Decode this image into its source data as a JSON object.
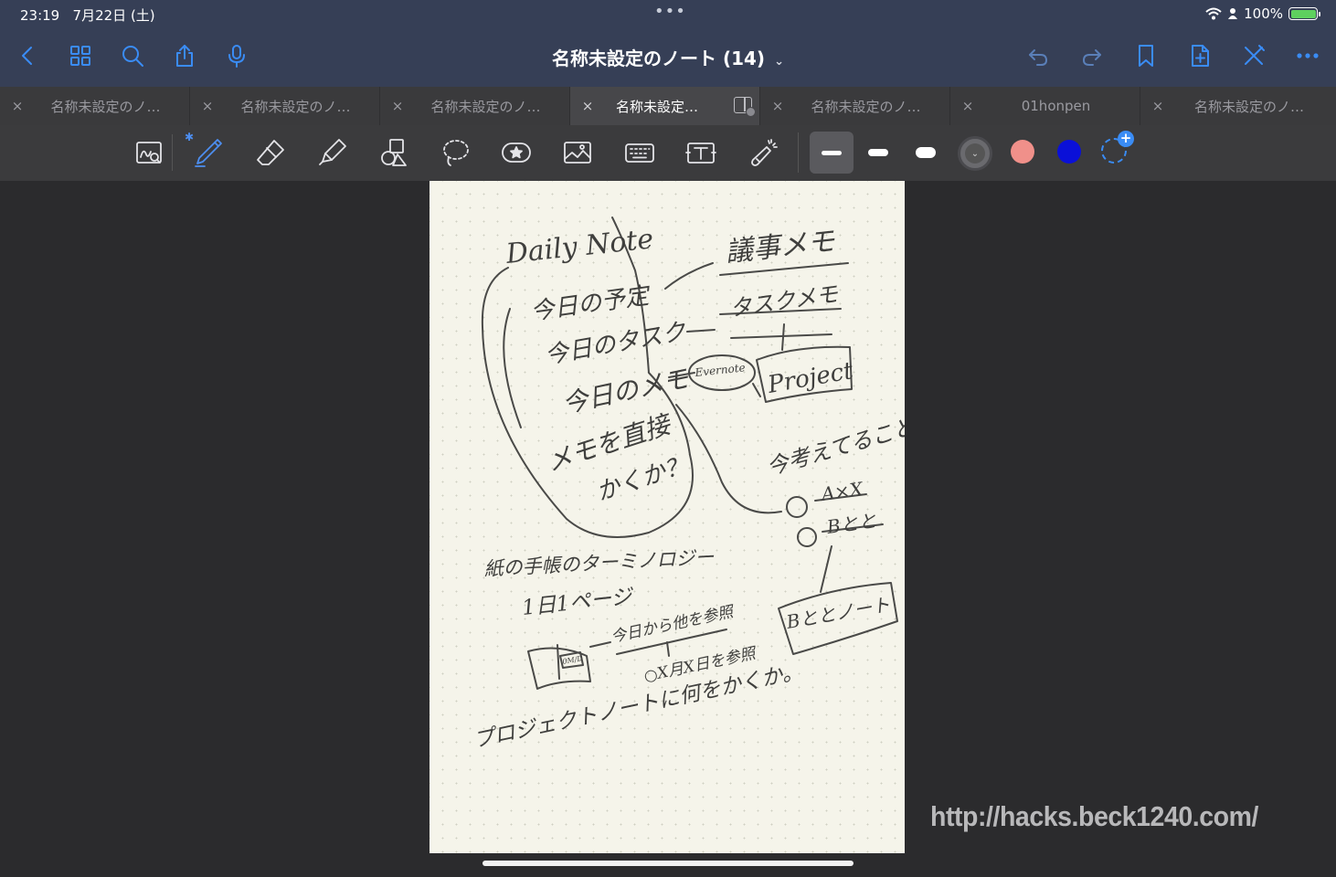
{
  "status": {
    "time": "23:19",
    "date": "7月22日 (土)",
    "battery": "100%",
    "dots": "•••"
  },
  "nav": {
    "title": "名称未設定のノート (14)",
    "title_chevron": "⌄",
    "left_icons": [
      "back-icon",
      "grid-icon",
      "search-icon",
      "share-icon",
      "microphone-icon"
    ],
    "right_icons": [
      "undo-icon",
      "redo-icon",
      "bookmark-icon",
      "add-page-icon",
      "close-pen-icon",
      "more-icon"
    ]
  },
  "tabs": [
    {
      "label": "名称未設定のノ…",
      "close": "×"
    },
    {
      "label": "名称未設定のノ…",
      "close": "×"
    },
    {
      "label": "名称未設定のノ…",
      "close": "×"
    },
    {
      "label": "名称未設定…",
      "close": "×",
      "active": true
    },
    {
      "label": "名称未設定のノ…",
      "close": "×"
    },
    {
      "label": "01honpen",
      "close": "×"
    },
    {
      "label": "名称未設定のノ…",
      "close": "×"
    }
  ],
  "toolbar": {
    "tools": [
      "zoom-window-icon",
      "pen-icon",
      "eraser-icon",
      "highlighter-icon",
      "shapes-icon",
      "lasso-icon",
      "sticker-icon",
      "image-icon",
      "keyboard-icon",
      "text-box-icon",
      "laser-pointer-icon"
    ],
    "bluetooth": "✱",
    "stroke_widths": [
      "thin",
      "medium",
      "thick"
    ],
    "colors": [
      "#5c5c60",
      "#f0908a",
      "#0a10d8"
    ],
    "add_color": "+"
  },
  "note": {
    "daily_note": "Daily Note",
    "today_plan": "今日の予定",
    "today_task": "今日のタスク",
    "today_memo": "今日のメモ",
    "memo_direct": "メモを直接",
    "write_q": "かくか？",
    "meeting_memo": "議事メモ",
    "task_memo": "タスクメモ",
    "evernote": "Evernote",
    "project": "Project",
    "thinking": "今考えてること",
    "item_a": "A×X",
    "item_b": "Bとと",
    "b_note": "Bととノート",
    "terminology": "紙の手帳のターミノロジー",
    "one_day_page": "1日1ページ",
    "omm": "0M/D",
    "ref_from_today": "今日から他を参照",
    "ref_date": "○X月X日を参照",
    "project_note_q": "プロジェクトノートに何をかくか。"
  },
  "watermark": "http://hacks.beck1240.com/"
}
